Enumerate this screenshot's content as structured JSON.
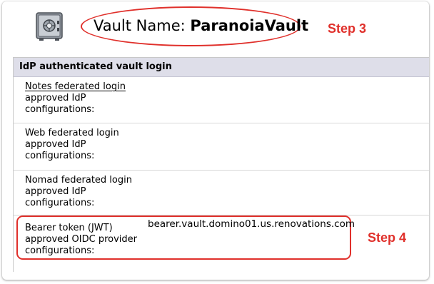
{
  "header": {
    "vault_name_label": "Vault Name:",
    "vault_name_value": "ParanoiaVault",
    "vault_icon": "safe-icon"
  },
  "annotations": {
    "step3": "Step 3",
    "step4": "Step 4",
    "highlight_color": "#e0302b"
  },
  "panel": {
    "title": "IdP authenticated vault login",
    "header_color": "#dedee9",
    "rows": [
      {
        "label_lines": [
          "Notes federated login",
          "approved IdP",
          "configurations:"
        ],
        "value": ""
      },
      {
        "label_lines": [
          "Web federated login",
          "approved IdP",
          "configurations:"
        ],
        "value": ""
      },
      {
        "label_lines": [
          "Nomad federated login",
          "approved IdP",
          "configurations:"
        ],
        "value": ""
      },
      {
        "label_lines": [
          "Bearer token (JWT)",
          "approved OIDC provider",
          "configurations:"
        ],
        "value": "bearer.vault.domino01.us.renovations.com"
      }
    ]
  }
}
